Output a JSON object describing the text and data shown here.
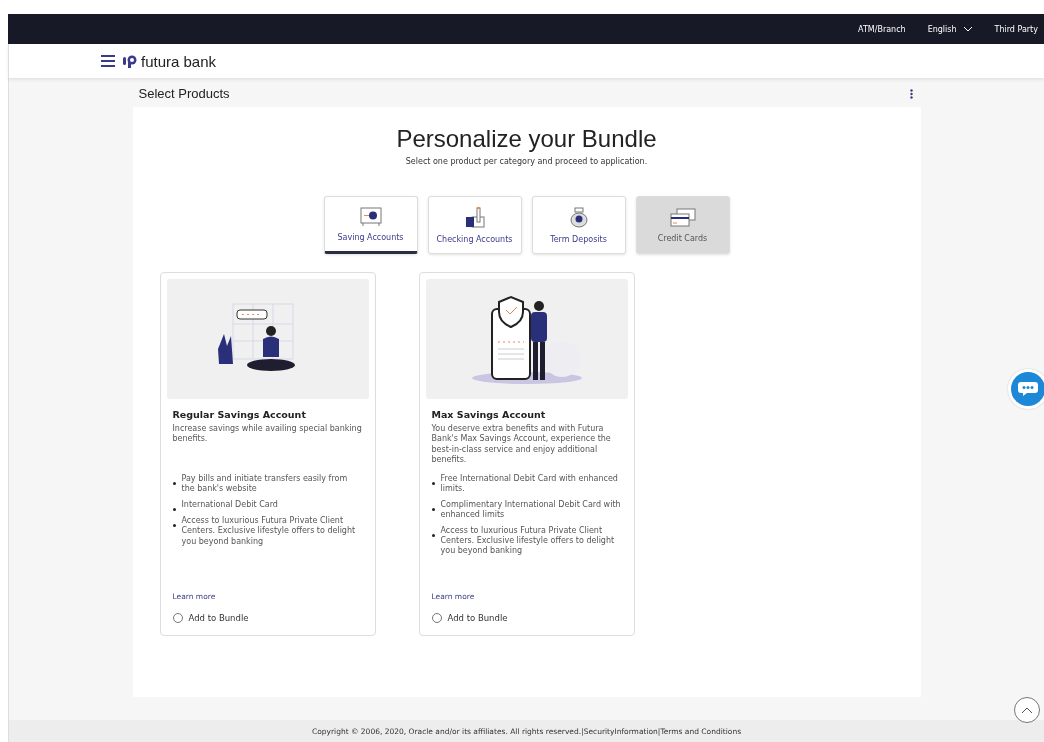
{
  "top_bar": {
    "links": [
      {
        "label": "ATM/Branch",
        "kind": "link"
      },
      {
        "label": "English",
        "kind": "dropdown"
      },
      {
        "label": "Third Party",
        "kind": "link"
      }
    ]
  },
  "header": {
    "brand": "futura bank"
  },
  "page_title": "Select Products",
  "heading": "Personalize your Bundle",
  "subheading": "Select one product per category and proceed to application.",
  "tabs": [
    {
      "label": "Saving Accounts",
      "selected": true,
      "disabled": false,
      "kind": "safe"
    },
    {
      "label": "Checking Accounts",
      "selected": false,
      "disabled": false,
      "kind": "check"
    },
    {
      "label": "Term Deposits",
      "selected": false,
      "disabled": false,
      "kind": "moneybag"
    },
    {
      "label": "Credit Cards",
      "selected": false,
      "disabled": true,
      "kind": "cards"
    }
  ],
  "products": [
    {
      "kind": "regular",
      "title": "Regular Savings Account",
      "description": "Increase savings while availing special banking benefits.",
      "features": [
        "Pay bills and initiate transfers easily from the bank's website",
        "International Debit Card",
        "Access to luxurious Futura Private Client Centers. Exclusive lifestyle offers to delight you beyond banking"
      ],
      "link": "Learn more",
      "option": {
        "label": "Add to Bundle",
        "checked": false
      }
    },
    {
      "kind": "max",
      "title": "Max Savings Account",
      "description": "You deserve extra benefits and with Futura Bank's Max Savings Account, experience the best-in-class service and enjoy additional benefits.",
      "features": [
        "Free International Debit Card with enhanced limits.",
        "Complimentary International Debit Card with enhanced limits",
        "Access to luxurious Futura Private Client Centers. Exclusive lifestyle offers to delight you beyond banking"
      ],
      "link": "Learn more",
      "option": {
        "label": "Add to Bundle",
        "checked": false
      }
    }
  ],
  "footer": "Copyright © 2006, 2020, Oracle and/or its affiliates. All rights reserved.|SecurityInformation|Terms and Conditions"
}
